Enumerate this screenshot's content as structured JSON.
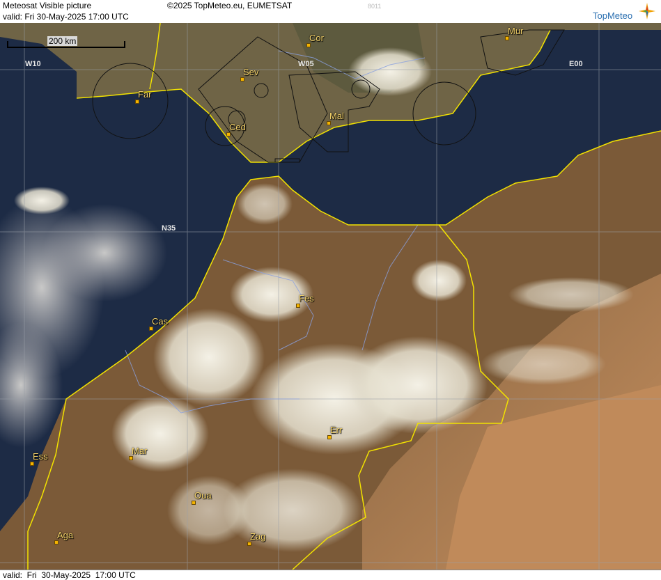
{
  "header": {
    "title": "Meteosat Visible picture",
    "copyright": "©2025 TopMeteo.eu, EUMETSAT",
    "code": "8011",
    "valid": "valid:  Fri  30-May-2025  17:00 UTC"
  },
  "logo": {
    "text": "TopMeteo",
    "icon": "star-compass-icon"
  },
  "footer": {
    "valid": "valid:  Fri  30-May-2025  17:00 UTC"
  },
  "scale_bar": {
    "label": "200 km"
  },
  "grid_labels": {
    "w10": "W10",
    "w05": "W05",
    "e00": "E00",
    "n35": "N35"
  },
  "cities": [
    {
      "id": "cor",
      "label": "Cor"
    },
    {
      "id": "mur",
      "label": "Mur"
    },
    {
      "id": "sev",
      "label": "Sev"
    },
    {
      "id": "far",
      "label": "Far"
    },
    {
      "id": "mal",
      "label": "Mal"
    },
    {
      "id": "ced",
      "label": "Ced"
    },
    {
      "id": "fes",
      "label": "Fes"
    },
    {
      "id": "cas",
      "label": "Cas"
    },
    {
      "id": "err",
      "label": "Err"
    },
    {
      "id": "ess",
      "label": "Ess"
    },
    {
      "id": "mar",
      "label": "Mar"
    },
    {
      "id": "oua",
      "label": "Oua"
    },
    {
      "id": "aga",
      "label": "Aga"
    },
    {
      "id": "zag",
      "label": "Zag"
    }
  ],
  "colors": {
    "sea": "#1b2a44",
    "land": "#7a5c3c",
    "desert": "#b07c52",
    "cloud": "#e8e4d6",
    "coastline": "#f2e200",
    "city_label": "#f5d36a",
    "grid": "#9aa0a8",
    "river": "#8aa0e0",
    "airspace": "#111111"
  }
}
